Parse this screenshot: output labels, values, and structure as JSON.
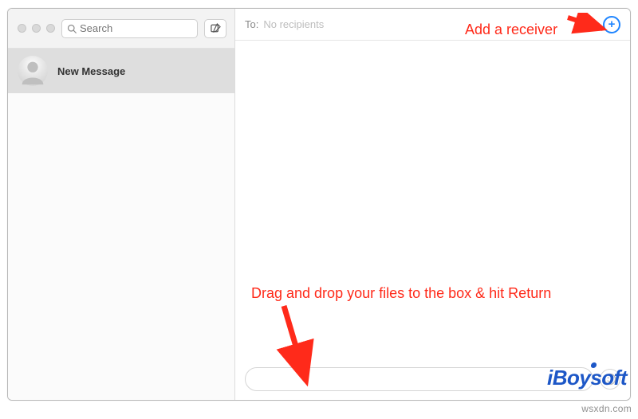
{
  "sidebar": {
    "search_placeholder": "Search",
    "conversations": [
      {
        "title": "New Message"
      }
    ]
  },
  "main": {
    "to_label": "To:",
    "to_value": "No recipients"
  },
  "annotations": {
    "add_receiver": "Add a receiver",
    "drag_drop": "Drag and drop your files to the box & hit Return"
  },
  "watermark": {
    "logo": "iBoysoft",
    "site": "wsxdn.com"
  },
  "colors": {
    "annotation": "#ff2a1a",
    "accent_blue": "#1f85ff",
    "logo_blue": "#1d57c7"
  }
}
